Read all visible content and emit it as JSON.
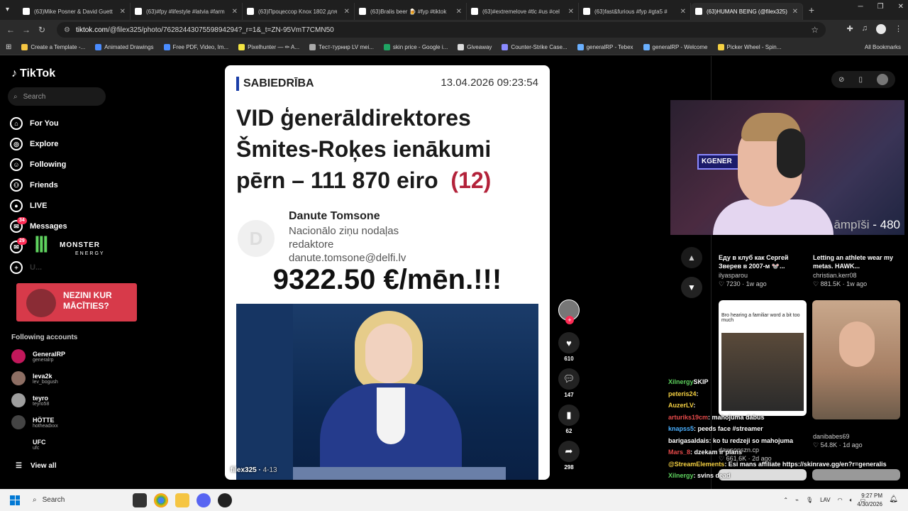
{
  "browser": {
    "tabs": [
      {
        "title": "(63)Mike Posner & David Guett"
      },
      {
        "title": "(63)#fpy #lifestyle #latvia #farm"
      },
      {
        "title": "(63)Процессор Knox 1802 для"
      },
      {
        "title": "(63)Bralis beer 🍺 #fyp #tiktok"
      },
      {
        "title": "(63)#extremelove #tlc #us #cel"
      },
      {
        "title": "(63)fast&furious #fyp #gta5 #"
      },
      {
        "title": "(63)HUMAN BEING (@filex325)"
      }
    ],
    "url_host": "tiktok.com",
    "url_path": "/@filex325/photo/7628244307559894294?_r=1&_t=ZN-95VmT7CMN50",
    "bookmarks": [
      {
        "label": "Create a Template -...",
        "color": "#f5c542"
      },
      {
        "label": "Animated Drawings",
        "color": "#4a8cff"
      },
      {
        "label": "Free PDF, Video, Im...",
        "color": "#4a8cff"
      },
      {
        "label": "Pixelhunter — ✏ A...",
        "color": "#f5e642"
      },
      {
        "label": "Тест-турнир LV mei...",
        "color": "#aaaaaa"
      },
      {
        "label": "skin price - Google i...",
        "color": "#1fa463"
      },
      {
        "label": "Giveaway",
        "color": "#dddddd"
      },
      {
        "label": "Counter-Strike Case...",
        "color": "#8a8aff"
      },
      {
        "label": "generalRP - Tebex",
        "color": "#6ab0ff"
      },
      {
        "label": "generalRP - Welcome",
        "color": "#6ab0ff"
      },
      {
        "label": "Picker Wheel - Spin...",
        "color": "#f5d142"
      }
    ],
    "all_bookmarks": "All Bookmarks"
  },
  "sidebar": {
    "logo": "TikTok",
    "search_placeholder": "Search",
    "nav": [
      {
        "label": "For You",
        "icon": "home-icon"
      },
      {
        "label": "Explore",
        "icon": "compass-icon"
      },
      {
        "label": "Following",
        "icon": "following-icon"
      },
      {
        "label": "Friends",
        "icon": "friends-icon"
      },
      {
        "label": "LIVE",
        "icon": "live-icon"
      },
      {
        "label": "Messages",
        "icon": "messages-icon",
        "badge": "34"
      },
      {
        "label": "",
        "icon": "activity-icon",
        "badge": "29"
      },
      {
        "label": "U...",
        "icon": "upload-icon"
      }
    ],
    "monster_brand": "MONSTER",
    "monster_sub": "ENERGY",
    "ad_text_line1": "NEZINI KUR",
    "ad_text_line2": "MĀCĪTIES?",
    "following_title": "Following accounts",
    "accounts": [
      {
        "name": "GeneralRP",
        "handle": "generalrp",
        "color": "#c2185b"
      },
      {
        "name": "leva2k",
        "handle": "lev_bogush",
        "color": "#8d6e63"
      },
      {
        "name": "teyro",
        "handle": "teyro58",
        "color": "#9e9e9e"
      },
      {
        "name": "HÖTTE",
        "handle": "hotheadxxx",
        "color": "#444444"
      },
      {
        "name": "UFC",
        "handle": "ufc",
        "color": "#000000"
      }
    ],
    "view_all": "View all"
  },
  "post": {
    "source": "SABIEDRĪBA",
    "datetime": "13.04.2026 09:23:54",
    "headline": "VID ģenerāldirektores Šmites-Roķes ienākumi pērn – 111 870 eiro",
    "headline_count": "(12)",
    "author_initial": "D",
    "author_name": "Danute Tomsone",
    "author_role": "Nacionālo ziņu nodaļas redaktore",
    "author_email": "danute.tomsone@delfi.lv",
    "salary_caption": "9322.50 €/mēn.!!!",
    "username": "filex325",
    "post_date": "4-13"
  },
  "actions": {
    "likes": "610",
    "comments": "147",
    "saves": "62",
    "shares": "298"
  },
  "right": {
    "webcam_sign": "KGENER",
    "counter_word": "āmpīši",
    "counter_value": "480",
    "cards": [
      {
        "title": "Еду в клуб как Сергей Зверев в 2007-м 🐭...",
        "author": "ilyasparou",
        "likes": "7230",
        "date": "1w ago"
      },
      {
        "title": "Letting an athlete wear my metas. HAWK...",
        "author": "christian.kerr08",
        "likes": "881.5K",
        "date": "1w ago"
      },
      {
        "title": "",
        "author": "dawsonszn.cp",
        "likes": "661.6K",
        "date": "2d ago"
      },
      {
        "title": "",
        "author": "danibabes69",
        "likes": "54.8K",
        "date": "1d ago"
      }
    ],
    "thumb_caption": "Bro hearing a familiar word a bit too much"
  },
  "chat": [
    {
      "user": "Xilnergy",
      "msg": "SKIP",
      "color": "#5fd35f"
    },
    {
      "user": "peteris24",
      "msg": ": ",
      "color": "#f5d142"
    },
    {
      "user": "AuzerLV",
      "msg": ": ",
      "color": "#f5d142"
    },
    {
      "user": "arturiks19cm",
      "msg": ": mahojuma dabus",
      "color": "#e64a4a"
    },
    {
      "user": "knapss5",
      "msg": ": peeds face #streamer",
      "color": "#4ab0ff"
    },
    {
      "user": "barigasaldais",
      "msg": ": ko tu redzeji so mahojuma",
      "color": "#ffffff"
    },
    {
      "user": "Mars_8",
      "msg": ": dzekam ir plans",
      "color": "#e64a4a"
    },
    {
      "user": "@StreamElements",
      "msg": ": Esi mans affiliate https://skinrave.gg/en?r=generalis",
      "color": "#f5d142"
    },
    {
      "user": "Xilnergy",
      "msg": ": svins dead",
      "color": "#5fd35f"
    }
  ],
  "taskbar": {
    "search": "Search",
    "lang": "LAV",
    "time": "9:27 PM",
    "date": "4/30/2026"
  }
}
